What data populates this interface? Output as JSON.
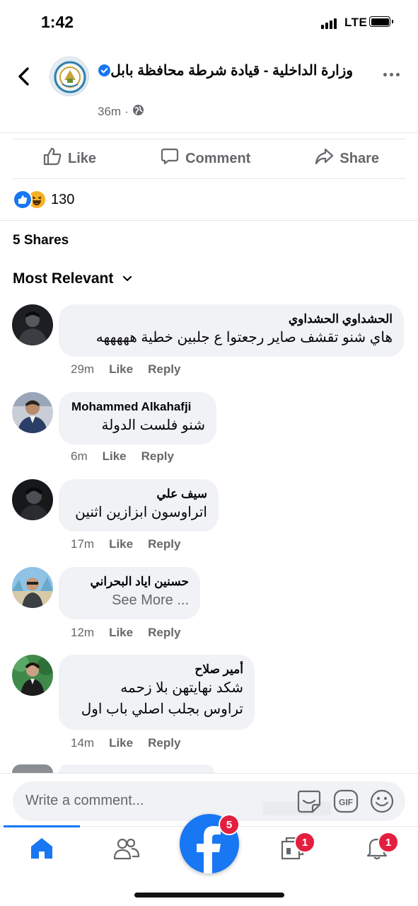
{
  "status_bar": {
    "time": "1:42",
    "network": "LTE"
  },
  "post": {
    "page_name": "وزارة الداخلية - قيادة شرطة محافظة بابل",
    "time": "36m",
    "privacy_icon": "globe-icon"
  },
  "actions": {
    "like": "Like",
    "comment": "Comment",
    "share": "Share"
  },
  "reactions": {
    "count": "130",
    "types": [
      "like",
      "haha"
    ]
  },
  "shares": "5 Shares",
  "sort_label": "Most Relevant",
  "comments": [
    {
      "name": "الحشداوي الحشداوي",
      "lines": [
        "هاي شنو تقشف صاير رجعتوا ع جلبين خطية هههههه"
      ],
      "time": "29m",
      "like": "Like",
      "reply": "Reply"
    },
    {
      "name": "Mohammed Alkahafji",
      "lines": [
        "شنو فلست الدولة"
      ],
      "time": "6m",
      "like": "Like",
      "reply": "Reply"
    },
    {
      "name": "سيف علي",
      "lines": [
        "اتراوسون ابزازين اثنين"
      ],
      "time": "17m",
      "like": "Like",
      "reply": "Reply"
    },
    {
      "name": "حسنين اياد البحراني",
      "lines": [
        "See More ..."
      ],
      "time": "12m",
      "like": "Like",
      "reply": "Reply"
    },
    {
      "name": "أمير صلاح",
      "lines": [
        "شكد نهايتهن بلا زحمه",
        "تراوس بجلب اصلي باب اول"
      ],
      "time": "14m",
      "like": "Like",
      "reply": "Reply"
    }
  ],
  "composer": {
    "placeholder": "Write a comment..."
  },
  "tab_bar": {
    "active": "home",
    "messenger_badge": "5",
    "pages_badge": "1",
    "notifications_badge": "1"
  },
  "colors": {
    "accent": "#1877f2",
    "badge": "#e41e3f",
    "muted": "#65676b",
    "bubble": "#f0f2f5"
  }
}
